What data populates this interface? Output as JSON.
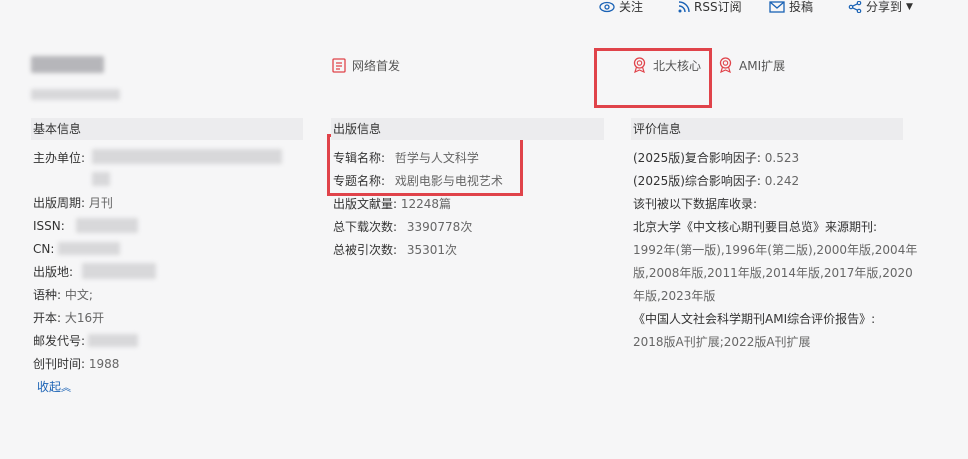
{
  "toolbar": {
    "follow": "关注",
    "rss": "RSS订阅",
    "submit": "投稿",
    "share": "分享到"
  },
  "tags": {
    "network_first": "网络首发",
    "pku_core": "北大核心",
    "ami_ext": "AMI扩展"
  },
  "colors": {
    "accent_red": "#e0434a",
    "link_blue": "#1a62b5",
    "header_bg": "#ececee"
  },
  "basic": {
    "heading": "基本信息",
    "sponsor_label": "主办单位:",
    "period_label": "出版周期:",
    "period_value": "月刊",
    "issn_label": "ISSN:",
    "cn_label": "CN:",
    "place_label": "出版地:",
    "lang_label": "语种:",
    "lang_value": "中文;",
    "format_label": "开本:",
    "format_value": "大16开",
    "postal_label": "邮发代号:",
    "founded_label": "创刊时间:",
    "founded_value": "1988",
    "collapse": "收起"
  },
  "publish": {
    "heading": "出版信息",
    "album_label": "专辑名称:",
    "album_value": "哲学与人文科学",
    "topic_label": "专题名称:",
    "topic_value": "戏剧电影与电视艺术",
    "volume_label": "出版文献量:",
    "volume_value": "12248篇",
    "downloads_label": "总下载次数:",
    "downloads_value": "3390778次",
    "citations_label": "总被引次数:",
    "citations_value": "35301次"
  },
  "eval": {
    "heading": "评价信息",
    "composite_label": "(2025版)复合影响因子:",
    "composite_value": "0.523",
    "comprehensive_label": "(2025版)综合影响因子:",
    "comprehensive_value": "0.242",
    "indexed_label": "该刊被以下数据库收录:",
    "pku_line": "北京大学《中文核心期刊要目总览》来源期刊:",
    "pku_years_1": "1992年(第一版),1996年(第二版),2000年版,2004年",
    "pku_years_2": "版,2008年版,2011年版,2014年版,2017年版,2020",
    "pku_years_3": "年版,2023年版",
    "ami_line": "《中国人文社会科学期刊AMI综合评价报告》:",
    "ami_years": "2018版A刊扩展;2022版A刊扩展"
  }
}
